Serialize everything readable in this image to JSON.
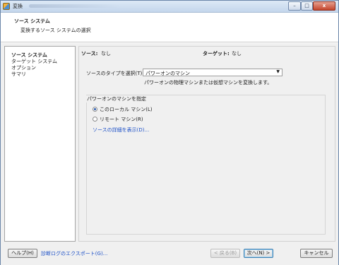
{
  "window": {
    "title": "変換",
    "min_glyph": "–",
    "max_glyph": "□",
    "close_glyph": "x"
  },
  "header": {
    "title": "ソース システム",
    "subtitle": "変換するソース システムの選択"
  },
  "sidebar": {
    "items": [
      {
        "label": "ソース システム",
        "active": true
      },
      {
        "label": "ターゲット システム",
        "active": false
      },
      {
        "label": "オプション",
        "active": false
      },
      {
        "label": "サマリ",
        "active": false
      }
    ]
  },
  "content": {
    "source_label": "ソース:",
    "source_value": "なし",
    "target_label": "ターゲット:",
    "target_value": "なし",
    "select_label": "ソースのタイプを選択(T):",
    "select_value": "パワーオンのマシン",
    "select_arrow": "▼",
    "select_description": "パワーオンの物理マシンまたは仮想マシンを変換します。",
    "group_title": "パワーオンのマシンを指定",
    "radio_local": "このローカル マシン(L)",
    "radio_remote": "リモート マシン(R)",
    "detail_link": "ソースの詳細を表示(D)..."
  },
  "footer": {
    "help_button": "ヘルプ(H)",
    "export_link": "診断ログのエクスポート(G)...",
    "back_button": "< 戻る(B)",
    "next_button": "次へ(N) >",
    "cancel_button": "キャンセル"
  }
}
